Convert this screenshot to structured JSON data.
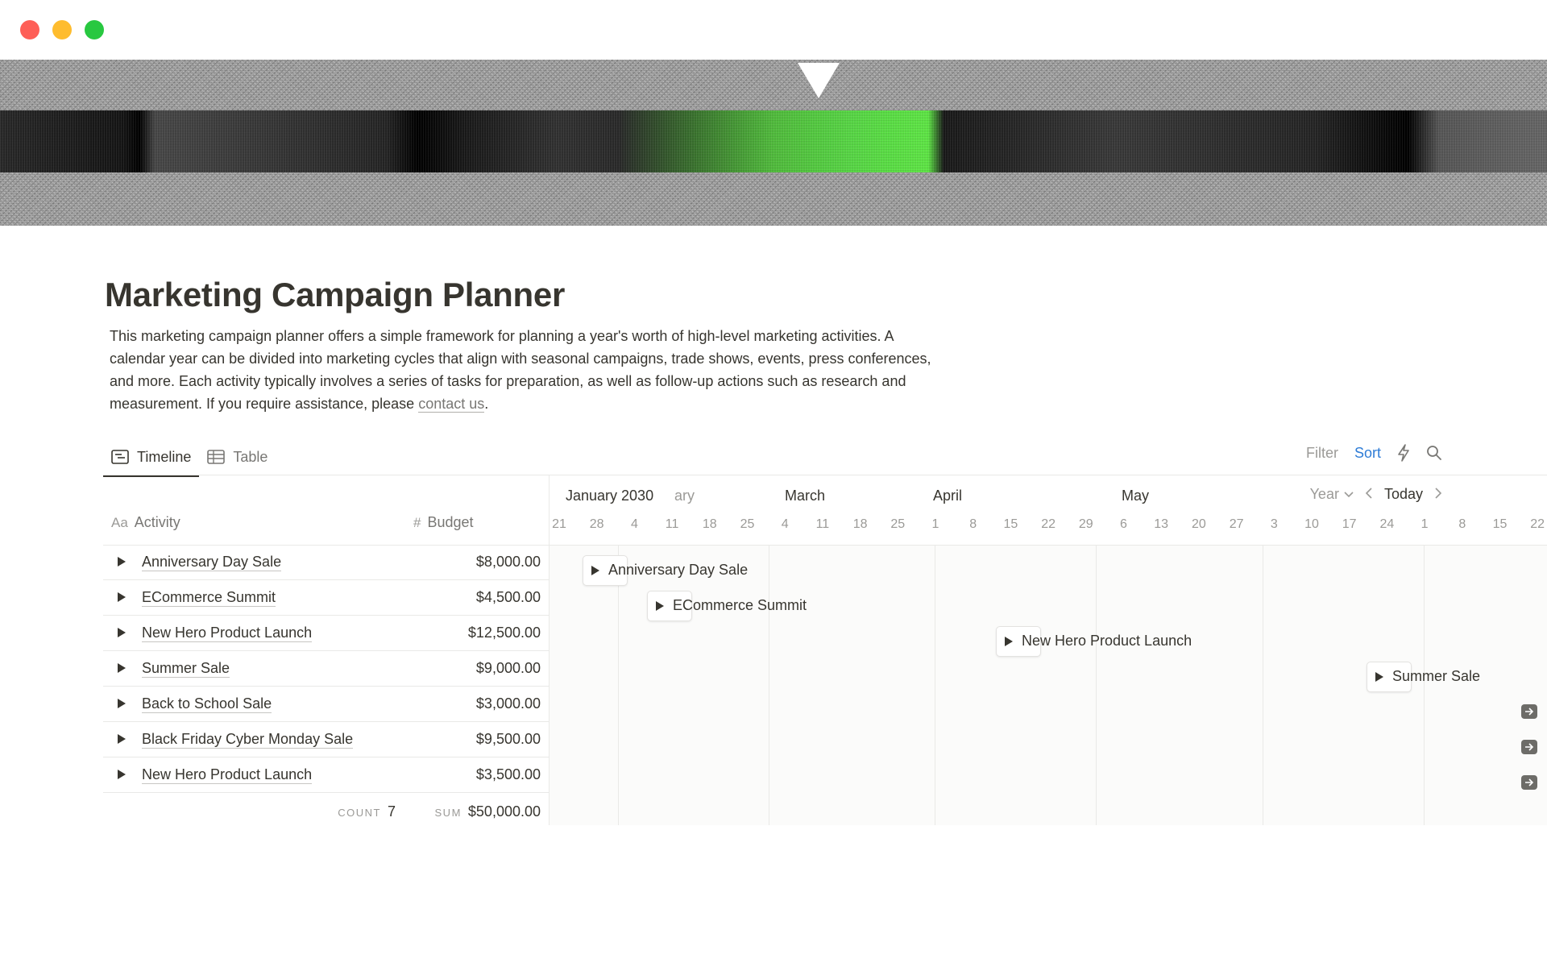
{
  "window": {
    "controls": [
      "close",
      "minimize",
      "zoom"
    ]
  },
  "page": {
    "title": "Marketing Campaign Planner",
    "description": "This marketing campaign planner offers a simple framework for planning a year's worth of high-level marketing activities. A calendar year can be divided into marketing cycles that align with seasonal campaigns, trade shows, events, press conferences, and more. Each activity typically involves a series of tasks for preparation, as well as follow-up actions such as research and measurement. If you require assistance, please ",
    "link_text": "contact us",
    "after_link": "."
  },
  "tabs": [
    {
      "label": "Timeline",
      "icon": "timeline-icon",
      "active": true
    },
    {
      "label": "Table",
      "icon": "table-icon",
      "active": false
    }
  ],
  "toolbar": {
    "filter": "Filter",
    "sort": "Sort",
    "sort_color": "#2e7cd6",
    "automation_icon": "lightning-icon",
    "search_icon": "search-icon"
  },
  "table": {
    "columns": {
      "activity_prefix": "Aa",
      "activity": "Activity",
      "budget_prefix": "#",
      "budget": "Budget"
    },
    "rows": [
      {
        "name": "Anniversary Day Sale",
        "budget": "$8,000.00"
      },
      {
        "name": "ECommerce Summit",
        "budget": "$4,500.00"
      },
      {
        "name": "New Hero Product Launch",
        "budget": "$12,500.00"
      },
      {
        "name": "Summer Sale",
        "budget": "$9,000.00"
      },
      {
        "name": "Back to School Sale",
        "budget": "$3,000.00"
      },
      {
        "name": "Black Friday Cyber Monday Sale",
        "budget": "$9,500.00"
      },
      {
        "name": "New Hero Product Launch",
        "budget": "$3,500.00"
      }
    ],
    "footer": {
      "count_label": "COUNT",
      "count_value": "7",
      "sum_label": "SUM",
      "sum_value": "$50,000.00"
    }
  },
  "timeline": {
    "months": [
      "January 2030",
      "ary",
      "March",
      "April",
      "May"
    ],
    "days": [
      "21",
      "28",
      "4",
      "11",
      "18",
      "25",
      "4",
      "11",
      "18",
      "25",
      "1",
      "8",
      "15",
      "22",
      "29",
      "6",
      "13",
      "20",
      "27",
      "3",
      "10",
      "17",
      "24",
      "1",
      "8",
      "15",
      "22"
    ],
    "nav": {
      "year": "Year",
      "today": "Today"
    },
    "bars": [
      {
        "label": "Anniversary Day Sale"
      },
      {
        "label": "ECommerce Summit"
      },
      {
        "label": "New Hero Product Launch"
      },
      {
        "label": "Summer Sale"
      }
    ],
    "offscreen_rows": 3
  }
}
